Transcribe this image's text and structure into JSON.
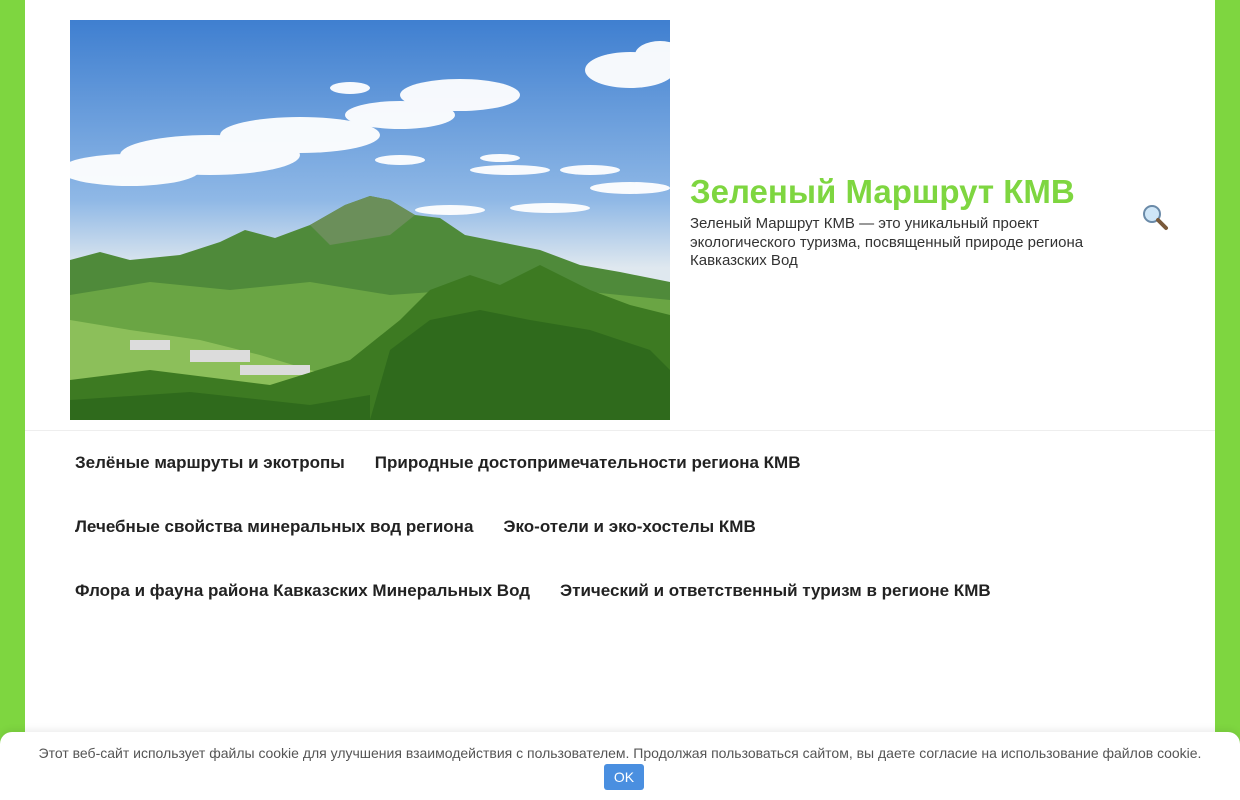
{
  "header": {
    "site_title": "Зеленый Маршрут КМВ",
    "site_description": "Зеленый Маршрут КМВ — это уникальный проект экологического туризма, посвященный природе региона Кавказских Вод",
    "search_icon": "search-icon"
  },
  "colors": {
    "accent": "#7ed640",
    "cookie_button": "#4a8fe0"
  },
  "nav": {
    "rows": [
      [
        "Зелёные маршруты и экотропы",
        "Природные достопримечательности региона КМВ"
      ],
      [
        "Лечебные свойства минеральных вод региона",
        "Эко-отели и эко-хостелы КМВ"
      ],
      [
        "Флора и фауна района Кавказских Минеральных Вод",
        "Этический и ответственный туризм в регионе КМВ"
      ]
    ]
  },
  "cookie": {
    "text": "Этот веб-сайт использует файлы cookie для улучшения взаимодействия с пользователем. Продолжая пользоваться сайтом, вы даете согласие на использование файлов cookie.",
    "ok_label": "OK"
  }
}
